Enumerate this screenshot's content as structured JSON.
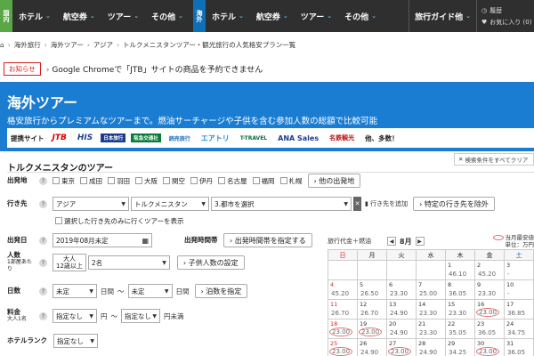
{
  "nav": {
    "domestic_badge": "国内",
    "domestic_items": [
      "ホテル",
      "航空券",
      "ツアー",
      "その他"
    ],
    "intl_badge": "海外",
    "intl_items": [
      "ホテル",
      "航空券",
      "ツアー",
      "その他"
    ],
    "guide_label": "旅行ガイド他",
    "history_label": "履歴",
    "favorites_label": "お気に入り (0)"
  },
  "breadcrumb": [
    "海外旅行",
    "海外ツアー",
    "アジア",
    "トルクメニスタンツアー・観光旅行の人気格安プラン一覧"
  ],
  "notice": {
    "badge": "お知らせ",
    "text": "Google Chromeで「JTB」サイトの商品を予約できません"
  },
  "hero": {
    "title": "海外ツアー",
    "subtitle": "格安旅行からプレミアムなツアーまで。燃油サーチャージや子供を含む参加人数の総額で比較可能",
    "partners_label": "提携サイト",
    "partners": [
      "JTB",
      "HIS",
      "日本旅行",
      "阪急交通社",
      "読売旅行",
      "エアトリ",
      "T-TRAVEL",
      "ANA Sales",
      "名鉄観光",
      "他、多数！"
    ]
  },
  "search": {
    "section_title": "トルクメニスタンのツアー",
    "all_conditions": "検索条件をすべてクリア",
    "departure": {
      "label": "出発地",
      "options": [
        "東京",
        "成田",
        "羽田",
        "大阪",
        "関空",
        "伊丹",
        "名古屋",
        "福岡",
        "札幌"
      ],
      "other_button": "他の出発地"
    },
    "destination": {
      "label": "行き先",
      "region": "アジア",
      "country": "トルクメニスタン",
      "city": "3.都市を選択",
      "add_label": "行き先を追加",
      "exclude_button": "特定の行き先を除外",
      "only_selected": "選択した行き先のみに行くツアーを表示"
    },
    "departure_date": {
      "label": "出発日",
      "value": "2019年08月未定",
      "time_label": "出発時間帯",
      "time_button": "出発時間帯を指定する"
    },
    "people": {
      "label": "人数",
      "sublabel": "1部屋あたり",
      "adult_label": "大人",
      "adult_sub": "12歳以上",
      "adult_value": "2名",
      "child_button": "子供人数の設定"
    },
    "days": {
      "label": "日数",
      "from": "未定",
      "to": "未定",
      "unit": "日間",
      "tilde": "〜",
      "nights_button": "泊数を指定"
    },
    "price": {
      "label": "料金",
      "sublabel": "大人1名",
      "from": "指定なし",
      "unit_from": "円",
      "tilde": "〜",
      "to": "指定なし",
      "unit_to": "円未満"
    },
    "hotel_rank": {
      "label": "ホテルランク",
      "value": "指定なし"
    }
  },
  "calendar": {
    "header_label": "旅行代金＋燃油",
    "month": "8月",
    "note_line1": "当月最安値",
    "note_line2": "単位：万円",
    "dow": [
      "日",
      "月",
      "火",
      "水",
      "木",
      "金",
      "土"
    ],
    "weeks": [
      [
        {
          "d": "",
          "p": ""
        },
        {
          "d": "",
          "p": ""
        },
        {
          "d": "",
          "p": ""
        },
        {
          "d": "",
          "p": ""
        },
        {
          "d": "1",
          "p": "46.10"
        },
        {
          "d": "2",
          "p": "45.20"
        },
        {
          "d": "3",
          "p": "-"
        }
      ],
      [
        {
          "d": "4",
          "p": "45.20"
        },
        {
          "d": "5",
          "p": "26.50"
        },
        {
          "d": "6",
          "p": "23.30"
        },
        {
          "d": "7",
          "p": "25.00"
        },
        {
          "d": "8",
          "p": "36.05"
        },
        {
          "d": "9",
          "p": "23.30"
        },
        {
          "d": "10",
          "p": "-"
        }
      ],
      [
        {
          "d": "11",
          "p": "26.70"
        },
        {
          "d": "12",
          "p": "26.70"
        },
        {
          "d": "13",
          "p": "24.90"
        },
        {
          "d": "14",
          "p": "23.30"
        },
        {
          "d": "15",
          "p": "23.30"
        },
        {
          "d": "16",
          "p": "23.00"
        },
        {
          "d": "17",
          "p": "36.85"
        }
      ],
      [
        {
          "d": "18",
          "p": "23.00"
        },
        {
          "d": "19",
          "p": "23.00"
        },
        {
          "d": "20",
          "p": "24.90"
        },
        {
          "d": "21",
          "p": "23.30"
        },
        {
          "d": "22",
          "p": "35.05"
        },
        {
          "d": "23",
          "p": "36.05"
        },
        {
          "d": "24",
          "p": "34.75"
        }
      ],
      [
        {
          "d": "25",
          "p": "23.00"
        },
        {
          "d": "26",
          "p": "24.90"
        },
        {
          "d": "27",
          "p": "23.00"
        },
        {
          "d": "28",
          "p": "24.90"
        },
        {
          "d": "29",
          "p": "34.25"
        },
        {
          "d": "30",
          "p": "23.00"
        },
        {
          "d": "31",
          "p": "36.05"
        }
      ]
    ],
    "highlighted": [
      "23.00"
    ]
  }
}
